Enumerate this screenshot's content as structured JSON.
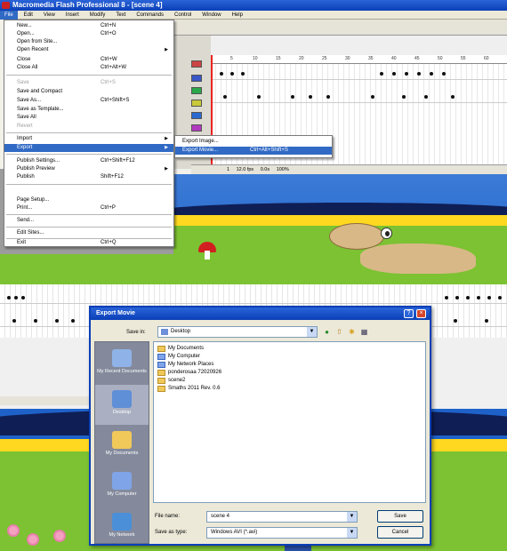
{
  "window_title": "Macromedia Flash Professional 8 - [scene 4]",
  "menubar": [
    "File",
    "Edit",
    "View",
    "Insert",
    "Modify",
    "Text",
    "Commands",
    "Control",
    "Window",
    "Help"
  ],
  "file_menu": {
    "new": {
      "label": "New...",
      "shortcut": "Ctrl+N"
    },
    "open": {
      "label": "Open...",
      "shortcut": "Ctrl+O"
    },
    "open_from_site": {
      "label": "Open from Site..."
    },
    "open_recent": {
      "label": "Open Recent"
    },
    "close": {
      "label": "Close",
      "shortcut": "Ctrl+W"
    },
    "close_all": {
      "label": "Close All",
      "shortcut": "Ctrl+Alt+W"
    },
    "save": {
      "label": "Save",
      "shortcut": "Ctrl+S"
    },
    "save_compact": {
      "label": "Save and Compact"
    },
    "save_as": {
      "label": "Save As...",
      "shortcut": "Ctrl+Shift+S"
    },
    "save_as_template": {
      "label": "Save as Template..."
    },
    "save_all": {
      "label": "Save All"
    },
    "revert": {
      "label": "Revert"
    },
    "import": {
      "label": "Import"
    },
    "export": {
      "label": "Export"
    },
    "publish_settings": {
      "label": "Publish Settings...",
      "shortcut": "Ctrl+Shift+F12"
    },
    "publish_preview": {
      "label": "Publish Preview"
    },
    "publish": {
      "label": "Publish",
      "shortcut": "Shift+F12"
    },
    "page_setup": {
      "label": "Page Setup..."
    },
    "print": {
      "label": "Print...",
      "shortcut": "Ctrl+P"
    },
    "send": {
      "label": "Send..."
    },
    "edit_sites": {
      "label": "Edit Sites..."
    },
    "exit": {
      "label": "Exit",
      "shortcut": "Ctrl+Q"
    }
  },
  "export_submenu": {
    "export_image": {
      "label": "Export Image..."
    },
    "export_movie": {
      "label": "Export Movie...",
      "shortcut": "Ctrl+Alt+Shift+S"
    }
  },
  "timeline_status": {
    "frame": "1",
    "fps": "12.0 fps",
    "time": "0.0s",
    "zoom": "100%"
  },
  "ruler_ticks": [
    "5",
    "10",
    "15",
    "20",
    "25",
    "30",
    "35",
    "40",
    "45",
    "50",
    "55",
    "60"
  ],
  "export_dialog": {
    "title": "Export Movie",
    "save_in_label": "Save in:",
    "save_in_value": "Desktop",
    "places": [
      "My Recent Documents",
      "Desktop",
      "My Documents",
      "My Computer",
      "My Network"
    ],
    "files": [
      "My Documents",
      "My Computer",
      "My Network Places",
      "ponderosaa 72020926",
      "scene2",
      "Smaths 2011 Rev. 0.6"
    ],
    "file_name_label": "File name:",
    "file_name_value": "scene 4",
    "save_as_type_label": "Save as type:",
    "save_as_type_value": "Windows AVI (*.avi)",
    "save_button": "Save",
    "cancel_button": "Cancel"
  },
  "colors": {
    "titlebar": "#0a3fb7",
    "highlight": "#316ac5",
    "sky": "#1e62c9",
    "grass": "#7cc232",
    "sun": "#ffd81f"
  }
}
